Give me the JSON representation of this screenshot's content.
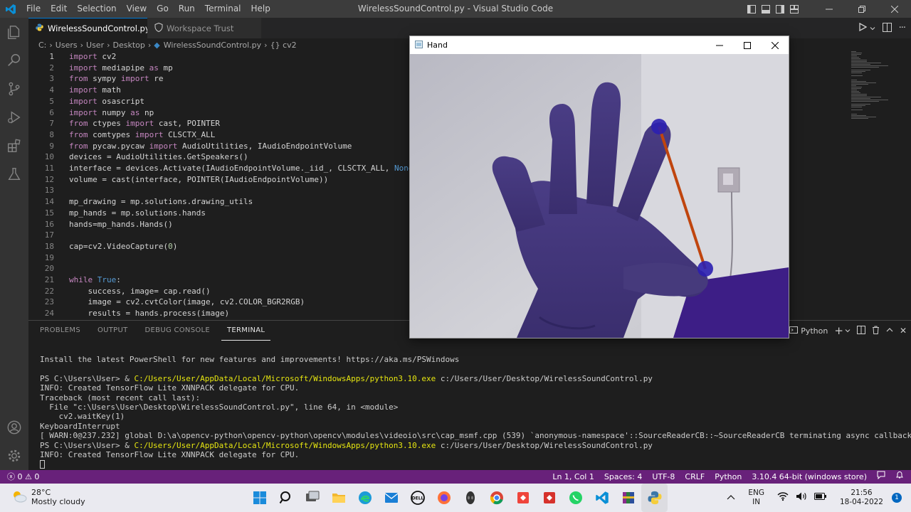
{
  "window": {
    "title": "WirelessSoundControl.py - Visual Studio Code",
    "menu": [
      "File",
      "Edit",
      "Selection",
      "View",
      "Go",
      "Run",
      "Terminal",
      "Help"
    ]
  },
  "tabs": [
    {
      "label": "WirelessSoundControl.py",
      "active": true
    },
    {
      "label": "Workspace Trust",
      "active": false
    }
  ],
  "breadcrumb": [
    "C:",
    "Users",
    "User",
    "Desktop",
    "WirelessSoundControl.py",
    "{} cv2"
  ],
  "editor": {
    "lines": [
      {
        "n": "1",
        "text": "import cv2"
      },
      {
        "n": "2",
        "text": "import mediapipe as mp"
      },
      {
        "n": "3",
        "text": "from sympy import re"
      },
      {
        "n": "4",
        "text": "import math"
      },
      {
        "n": "5",
        "text": "import osascript"
      },
      {
        "n": "6",
        "text": "import numpy as np"
      },
      {
        "n": "7",
        "text": "from ctypes import cast, POINTER"
      },
      {
        "n": "8",
        "text": "from comtypes import CLSCTX_ALL"
      },
      {
        "n": "9",
        "text": "from pycaw.pycaw import AudioUtilities, IAudioEndpointVolume"
      },
      {
        "n": "10",
        "text": "devices = AudioUtilities.GetSpeakers()"
      },
      {
        "n": "11",
        "text": "interface = devices.Activate(IAudioEndpointVolume._iid_, CLSCTX_ALL, None)"
      },
      {
        "n": "12",
        "text": "volume = cast(interface, POINTER(IAudioEndpointVolume))"
      },
      {
        "n": "13",
        "text": ""
      },
      {
        "n": "14",
        "text": "mp_drawing = mp.solutions.drawing_utils"
      },
      {
        "n": "15",
        "text": "mp_hands = mp.solutions.hands"
      },
      {
        "n": "16",
        "text": "hands=mp_hands.Hands()"
      },
      {
        "n": "17",
        "text": ""
      },
      {
        "n": "18",
        "text": "cap=cv2.VideoCapture(0)"
      },
      {
        "n": "19",
        "text": ""
      },
      {
        "n": "20",
        "text": ""
      },
      {
        "n": "21",
        "text": "while True:"
      },
      {
        "n": "22",
        "text": "    success, image= cap.read()"
      },
      {
        "n": "23",
        "text": "    image = cv2.cvtColor(image, cv2.COLOR_BGR2RGB)"
      },
      {
        "n": "24",
        "text": "    results = hands.process(image)"
      }
    ]
  },
  "panel": {
    "tabs": [
      "PROBLEMS",
      "OUTPUT",
      "DEBUG CONSOLE",
      "TERMINAL"
    ],
    "active_tab": "TERMINAL",
    "shell": "Python",
    "terminal": {
      "line_ps_notice": "Install the latest PowerShell for new features and improvements! https://aka.ms/PSWindows",
      "prompt": "PS C:\\Users\\User> & ",
      "python_path": "C:/Users/User/AppData/Local/Microsoft/WindowsApps/python3.10.exe",
      "script_path": " c:/Users/User/Desktop/WirelessSoundControl.py",
      "info_tf": "INFO: Created TensorFlow Lite XNNPACK delegate for CPU.",
      "traceback": "Traceback (most recent call last):",
      "file_line": "  File \"c:\\Users\\User\\Desktop\\WirelessSoundControl.py\", line 64, in <module>",
      "wait_key": "    cv2.waitKey(1)",
      "keyboard_interrupt": "KeyboardInterrupt",
      "warn": "[ WARN:0@237.232] global D:\\a\\opencv-python\\opencv-python\\opencv\\modules\\videoio\\src\\cap_msmf.cpp (539) `anonymous-namespace'::SourceReaderCB::~SourceReaderCB terminating async callback"
    }
  },
  "statusbar": {
    "errors": "0",
    "warnings": "0",
    "position": "Ln 1, Col 1",
    "spaces": "Spaces: 4",
    "encoding": "UTF-8",
    "eol": "CRLF",
    "language": "Python",
    "interpreter": "3.10.4 64-bit (windows store)"
  },
  "hand_window": {
    "title": "Hand"
  },
  "taskbar": {
    "weather_temp": "28°C",
    "weather_desc": "Mostly cloudy",
    "lang_line1": "ENG",
    "lang_line2": "IN",
    "time": "21:56",
    "date": "18-04-2022",
    "notification_count": "1",
    "apps": [
      "start-icon",
      "search-icon",
      "task-view-icon",
      "file-explorer-icon",
      "edge-icon",
      "mail-icon",
      "dell-icon",
      "firefox-icon",
      "alienware-icon",
      "chrome-icon",
      "anydesk-icon",
      "anydesk-red-icon",
      "whatsapp-icon",
      "vscode-icon",
      "winrar-icon",
      "python-icon"
    ]
  },
  "colors": {
    "accent": "#0078d4",
    "statusbar": "#68217a",
    "keyword": "#c586c0",
    "constant": "#569cd6",
    "terminal_path": "#e5e510"
  }
}
